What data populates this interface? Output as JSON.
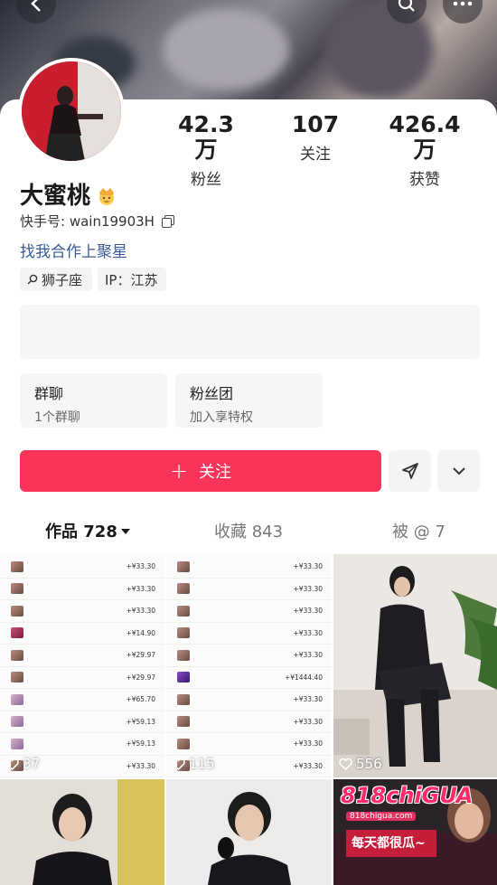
{
  "header": {
    "back_icon": "chevron-left-icon",
    "search_icon": "search-icon",
    "more_icon": "more-horizontal-icon"
  },
  "profile": {
    "name": "大蜜桃",
    "badge_icon": "crown-emoji-icon",
    "user_id": "快手号: wain19903H",
    "bio": "找我合作上聚星",
    "tags": [
      {
        "icon": "search-icon",
        "label": "狮子座"
      },
      {
        "label": "IP：江苏"
      }
    ]
  },
  "stats": [
    {
      "value": "42.3万",
      "label": "粉丝"
    },
    {
      "value": "107",
      "label": "关注"
    },
    {
      "value": "426.4万",
      "label": "获赞"
    }
  ],
  "groups": [
    {
      "title": "群聊",
      "subtitle": "1个群聊"
    },
    {
      "title": "粉丝团",
      "subtitle": "加入享特权"
    }
  ],
  "actions": {
    "follow_label": "关注",
    "share_icon": "send-icon",
    "expand_icon": "chevron-down-icon",
    "accent_color": "#f9335a"
  },
  "tabs": [
    {
      "label": "作品 728",
      "active": true
    },
    {
      "label": "收藏 843",
      "active": false
    },
    {
      "label": "被 @ 7",
      "active": false
    }
  ],
  "grid": {
    "items": [
      {
        "likes": "37"
      },
      {
        "likes": "115"
      },
      {
        "likes": "556"
      }
    ],
    "promo_logo": "818chiGUA",
    "promo_site": "818chigua.com",
    "promo_slogan": "每天都很瓜~"
  }
}
